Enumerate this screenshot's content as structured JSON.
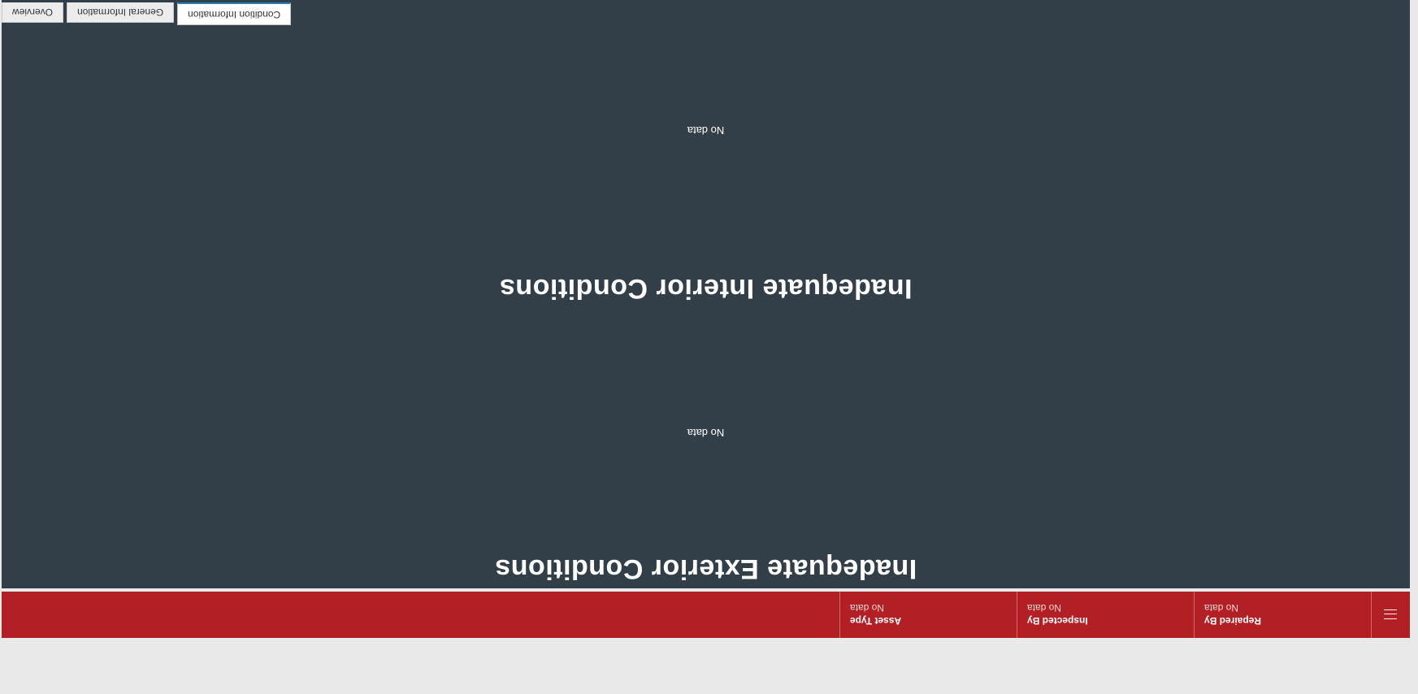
{
  "tabs": [
    {
      "label": "Overview",
      "active": false
    },
    {
      "label": "General Information",
      "active": false
    },
    {
      "label": "Condition Information",
      "active": true
    }
  ],
  "sections": {
    "exterior": {
      "title": "Inadequate Exterior Conditions",
      "empty_text": "No data"
    },
    "interior": {
      "title": "Inadequate Interior Conditions",
      "empty_text": "No data"
    }
  },
  "header": {
    "fields": [
      {
        "label": "Asset Type",
        "value": "No data"
      },
      {
        "label": "Inspected By",
        "value": "No data"
      },
      {
        "label": "Repaired By",
        "value": "No data"
      }
    ],
    "menu_icon": "hamburger-menu-icon"
  },
  "colors": {
    "header_bg": "#b22025",
    "panel_bg": "#333f48",
    "page_bg": "#e9e9e9",
    "active_tab_underline": "#2a7fb8"
  }
}
